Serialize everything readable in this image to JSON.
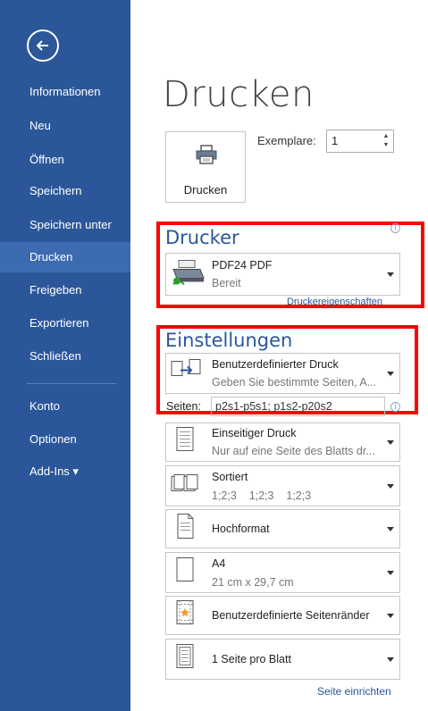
{
  "sidebar": {
    "items": [
      {
        "label": "Informationen"
      },
      {
        "label": "Neu"
      },
      {
        "label": "Öffnen"
      },
      {
        "label": "Speichern"
      },
      {
        "label": "Speichern unter"
      },
      {
        "label": "Drucken",
        "active": true
      },
      {
        "label": "Freigeben"
      },
      {
        "label": "Exportieren"
      },
      {
        "label": "Schließen"
      }
    ],
    "bottom_items": [
      {
        "label": "Konto"
      },
      {
        "label": "Optionen"
      },
      {
        "label": "Add-Ins ▾"
      }
    ]
  },
  "main": {
    "title": "Drucken",
    "print_button_label": "Drucken",
    "copies_label": "Exemplare:",
    "copies_value": "1"
  },
  "printer": {
    "section_title": "Drucker",
    "name": "PDF24 PDF",
    "status": "Bereit",
    "properties_link": "Druckereigenschaften"
  },
  "settings": {
    "section_title": "Einstellungen",
    "range": {
      "title": "Benutzerdefinierter Druck",
      "subtitle": "Geben Sie bestimmte Seiten, A..."
    },
    "pages_label": "Seiten:",
    "pages_value": "p2s1-p5s1; p1s2-p20s2",
    "sides": {
      "title": "Einseitiger Druck",
      "subtitle": "Nur auf eine Seite des Blatts dr..."
    },
    "collate": {
      "title": "Sortiert",
      "subtitle": "1;2;3    1;2;3    1;2;3"
    },
    "orientation": {
      "title": "Hochformat"
    },
    "paper": {
      "title": "A4",
      "subtitle": "21 cm x 29,7 cm"
    },
    "margins": {
      "title": "Benutzerdefinierte Seitenränder"
    },
    "per_sheet": {
      "title": "1 Seite pro Blatt"
    },
    "page_setup_link": "Seite einrichten"
  },
  "colors": {
    "sidebar": "#2b579a",
    "sidebar_active": "#3c6bb0",
    "highlight": "#ff0000",
    "accent": "#2b579a"
  }
}
